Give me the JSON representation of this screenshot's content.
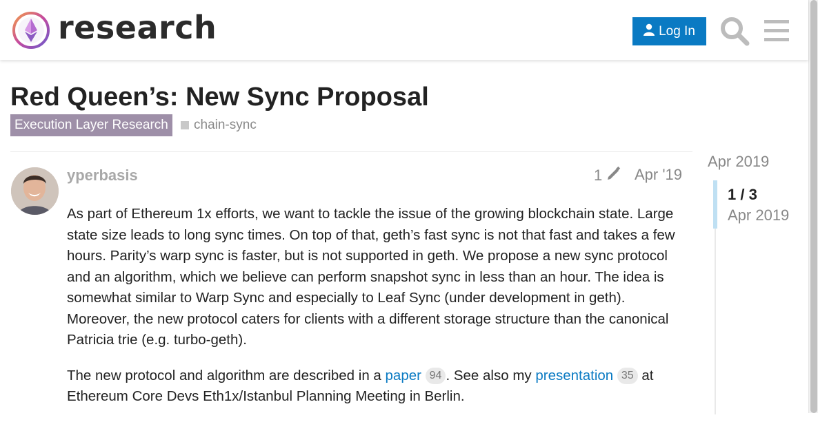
{
  "header": {
    "site_name": "research",
    "login_label": "Log In"
  },
  "topic": {
    "title": "Red Queen’s: New Sync Proposal",
    "category": "Execution Layer Research",
    "tag": "chain-sync",
    "category_color": "#9e8fa8"
  },
  "post": {
    "username": "yperbasis",
    "edit_count": "1",
    "date": "Apr '19",
    "paragraph1": "As part of Ethereum 1x efforts, we want to tackle the issue of the growing blockchain state. Large state size leads to long sync times. On top of that, geth’s fast sync is not that fast and takes a few hours. Parity’s warp sync is faster, but is not supported in geth. We propose a new sync protocol and an algorithm, which we believe can perform snapshot sync in less than an hour. The idea is somewhat similar to Warp Sync and especially to Leaf Sync (under development in geth). Moreover, the new protocol caters for clients with a different storage structure than the canonical Patricia trie (e.g. turbo-geth).",
    "p2_text1": "The new protocol and algorithm are described in a ",
    "p2_link1": "paper",
    "p2_count1": "94",
    "p2_text2": ". See also my ",
    "p2_link2": "presentation",
    "p2_count2": "35",
    "p2_text3": " at Ethereum Core Devs Eth1x/Istanbul Planning Meeting in Berlin."
  },
  "timeline": {
    "top_date": "Apr 2019",
    "position": "1 / 3",
    "current_date": "Apr 2019"
  },
  "colors": {
    "link": "#0a7ac3",
    "button": "#0a7ac3"
  },
  "icons": {
    "logo": "ethereum-research-logo",
    "user": "user-icon",
    "search": "search-icon",
    "menu": "hamburger-menu-icon",
    "edit": "pencil-icon"
  }
}
